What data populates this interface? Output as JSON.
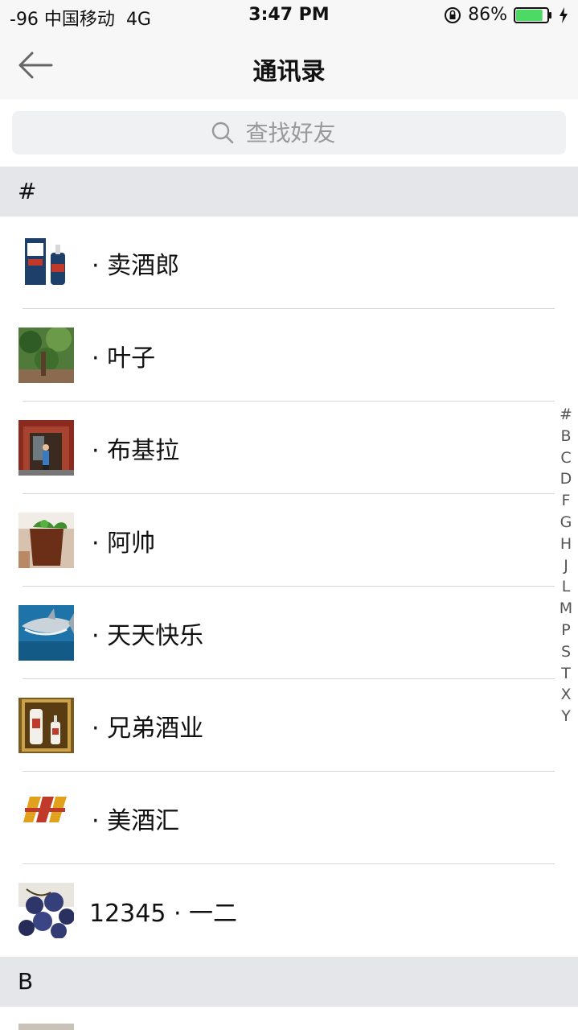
{
  "status_bar": {
    "signal": "-96 中国移动",
    "network": "4G",
    "time": "3:47 PM",
    "battery": "86%",
    "battery_level": 0.86,
    "battery_color": "#4cd964"
  },
  "nav": {
    "title": "通讯录",
    "back_icon": "arrow-left-icon"
  },
  "search": {
    "placeholder": "查找好友",
    "icon": "search-icon"
  },
  "sections": [
    {
      "header": "#",
      "contacts": [
        {
          "name": "· 卖酒郎",
          "avatar": "liquor-box-photo"
        },
        {
          "name": "· 叶子",
          "avatar": "garden-photo"
        },
        {
          "name": "· 布基拉",
          "avatar": "storefront-photo"
        },
        {
          "name": "· 阿帅",
          "avatar": "iced-drink-photo"
        },
        {
          "name": "· 天天快乐",
          "avatar": "shark-photo"
        },
        {
          "name": "· 兄弟酒业",
          "avatar": "liquor-bottles-photo"
        },
        {
          "name": "· 美酒汇",
          "avatar": "meijiuhui-logo"
        },
        {
          "name": "12345 · 一二",
          "avatar": "grapes-photo"
        }
      ]
    },
    {
      "header": "B",
      "contacts": []
    }
  ],
  "index_letters": [
    "#",
    "B",
    "C",
    "D",
    "F",
    "G",
    "H",
    "J",
    "L",
    "M",
    "P",
    "S",
    "T",
    "X",
    "Y"
  ],
  "colors": {
    "section_bg": "#e4e6e9",
    "search_bg": "#f0f1f3",
    "bar_bg": "#f7f7f7"
  }
}
